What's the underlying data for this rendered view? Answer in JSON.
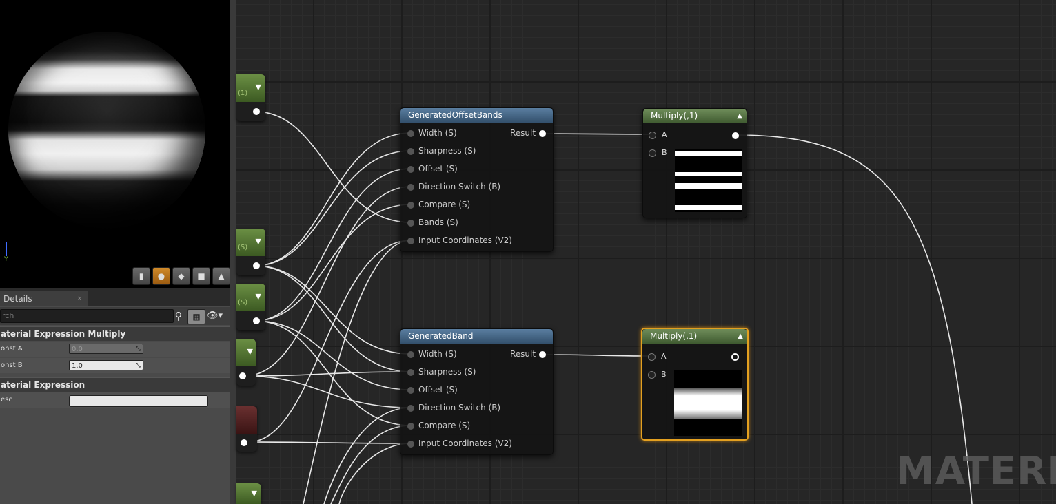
{
  "details": {
    "tab_label": "Details",
    "tab_close": "×",
    "search_placeholder": "rch",
    "categories": [
      {
        "title": "aterial Expression Multiply",
        "props": [
          {
            "name": "onst A",
            "value": "0.0",
            "enabled": false
          },
          {
            "name": "onst B",
            "value": "1.0",
            "enabled": true
          }
        ]
      },
      {
        "title": "aterial Expression",
        "props": [
          {
            "name": "esc",
            "value": ""
          }
        ]
      }
    ]
  },
  "viewport": {
    "axis_label": "Y",
    "toolbar_icons": [
      "cylinder-icon",
      "sphere-icon",
      "plane-icon",
      "cube-icon",
      "custom-mesh-icon"
    ],
    "active_tool": "sphere-icon"
  },
  "param_stubs": [
    {
      "label": "(1)",
      "color": "#5b7d3a"
    },
    {
      "label": "(S)",
      "color": "#5b7d3a"
    },
    {
      "label": "(S)",
      "color": "#5b7d3a"
    },
    {
      "label": "",
      "color": "#5b7d3a"
    },
    {
      "label": "",
      "color": "#5a2222"
    },
    {
      "label": "",
      "color": "#5b7d3a"
    }
  ],
  "nodes": {
    "generated_offset_bands": {
      "title": "GeneratedOffsetBands",
      "inputs": [
        "Width (S)",
        "Sharpness (S)",
        "Offset (S)",
        "Direction Switch (B)",
        "Compare (S)",
        "Bands (S)",
        "Input Coordinates (V2)"
      ],
      "output": "Result"
    },
    "generated_band": {
      "title": "GeneratedBand",
      "inputs": [
        "Width (S)",
        "Sharpness (S)",
        "Offset (S)",
        "Direction Switch (B)",
        "Compare (S)",
        "Input Coordinates (V2)"
      ],
      "output": "Result"
    },
    "multiply_top": {
      "title": "Multiply(,1)",
      "inputs": [
        "A",
        "B"
      ]
    },
    "multiply_bottom": {
      "title": "Multiply(,1)",
      "inputs": [
        "A",
        "B"
      ]
    }
  },
  "watermark": "MATERIA",
  "colors": {
    "function_header": "#4a6a8c",
    "multiply_header": "#5b7a48",
    "selection": "#e3a020",
    "param_header": "#5b7d3a"
  }
}
